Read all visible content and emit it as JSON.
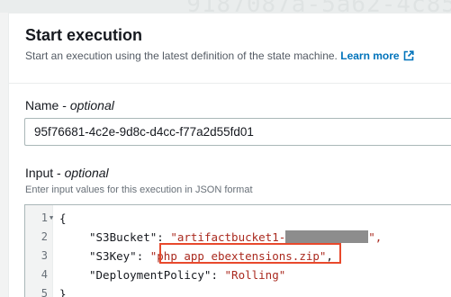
{
  "background_text": "9187087a-5a62-4c85",
  "header": {
    "title": "Start execution",
    "description": "Start an execution using the latest definition of the state machine.",
    "learn_more": "Learn more"
  },
  "name_field": {
    "label": "Name",
    "optional": "optional",
    "value": "95f76681-4c2e-9d8c-d4cc-f77a2d55fd01"
  },
  "input_field": {
    "label": "Input",
    "optional": "optional",
    "hint": "Enter input values for this execution in JSON format"
  },
  "editor": {
    "line_numbers": [
      "1",
      "2",
      "3",
      "4",
      "5"
    ],
    "brace_open": "{",
    "brace_close": "}",
    "lines": [
      {
        "key": "\"S3Bucket\"",
        "value": "\"artifactbucket1-",
        "suffix": "\","
      },
      {
        "key": "\"S3Key\"",
        "value": "\"php_app_ebextensions.zip\"",
        "suffix": ","
      },
      {
        "key": "\"DeploymentPolicy\"",
        "value": "\"Rolling\"",
        "suffix": ""
      }
    ]
  },
  "colors": {
    "link": "#0073bb",
    "string": "#aa2a1f",
    "highlight_box": "#e8492c"
  }
}
